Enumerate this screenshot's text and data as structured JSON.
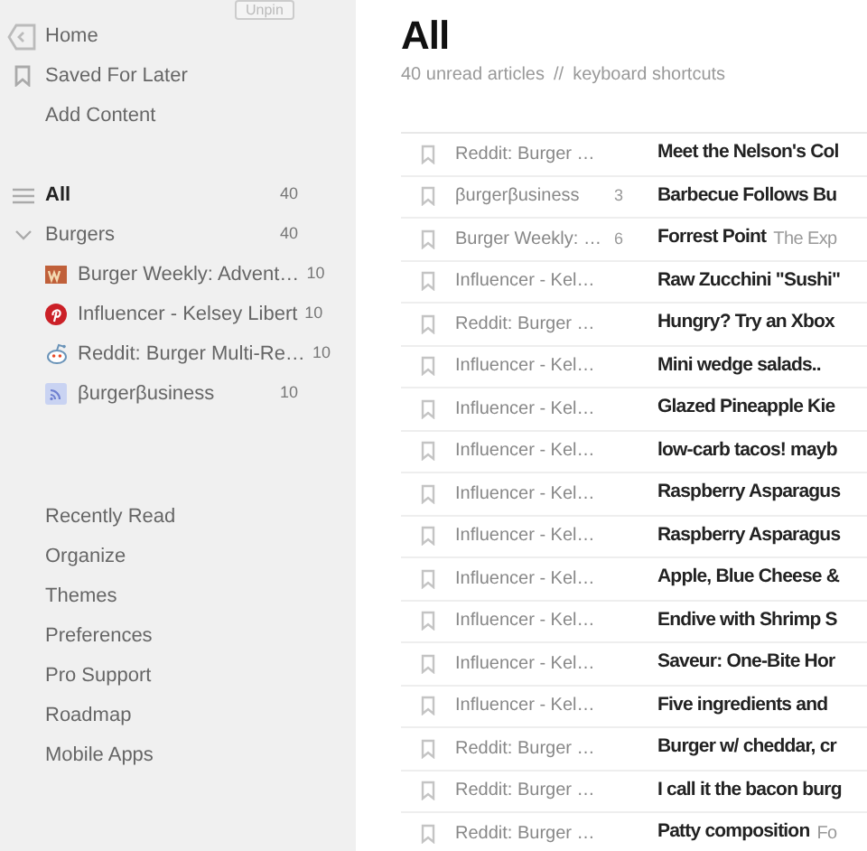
{
  "sidebar": {
    "unpin_button": "Unpin",
    "nav": [
      {
        "label": "Home",
        "kind": "home"
      },
      {
        "label": "Saved For Later",
        "kind": "saved"
      },
      {
        "label": "Add Content",
        "kind": "plain"
      }
    ],
    "all": {
      "label": "All",
      "count": "40",
      "selected": true
    },
    "category": {
      "label": "Burgers",
      "count": "40",
      "expanded": true,
      "feeds": [
        {
          "label": "Burger Weekly: Advent…",
          "count": "10",
          "kind": "rw"
        },
        {
          "label": "Influencer - Kelsey Libert",
          "count": "10",
          "kind": "pinterest"
        },
        {
          "label": "Reddit: Burger Multi-Re…",
          "count": "10",
          "kind": "reddit"
        },
        {
          "label": "βurgerβusiness",
          "count": "10",
          "kind": "rss"
        }
      ]
    },
    "links": [
      "Recently Read",
      "Organize",
      "Themes",
      "Preferences",
      "Pro Support",
      "Roadmap",
      "Mobile Apps"
    ]
  },
  "main": {
    "title": "All",
    "subtitle": "40 unread articles",
    "separator": "//",
    "shortcuts_link": "keyboard shortcuts",
    "articles": [
      {
        "source": "Reddit: Burger …",
        "title": "Meet the Nelson's Col"
      },
      {
        "source": "βurgerβusiness",
        "count": "3",
        "title": "Barbecue Follows Bu"
      },
      {
        "source": "Burger Weekly: …",
        "count": "6",
        "title": "Forrest Point",
        "snippet": "The Exp"
      },
      {
        "source": "Influencer - Kel…",
        "title": "Raw Zucchini \"Sushi\""
      },
      {
        "source": "Reddit: Burger …",
        "title": "Hungry? Try an Xbox"
      },
      {
        "source": "Influencer - Kel…",
        "title": "Mini wedge salads.."
      },
      {
        "source": "Influencer - Kel…",
        "title": "Glazed Pineapple Kie"
      },
      {
        "source": "Influencer - Kel…",
        "title": "low-carb tacos! mayb"
      },
      {
        "source": "Influencer - Kel…",
        "title": "Raspberry Asparagus"
      },
      {
        "source": "Influencer - Kel…",
        "title": "Raspberry Asparagus"
      },
      {
        "source": "Influencer - Kel…",
        "title": "Apple, Blue Cheese &"
      },
      {
        "source": "Influencer - Kel…",
        "title": "Endive with Shrimp S"
      },
      {
        "source": "Influencer - Kel…",
        "title": "Saveur: One-Bite Hor"
      },
      {
        "source": "Influencer - Kel…",
        "title": "Five ingredients and"
      },
      {
        "source": "Reddit: Burger …",
        "title": "Burger w/ cheddar, cr"
      },
      {
        "source": "Reddit: Burger …",
        "title": "I call it the bacon burg"
      },
      {
        "source": "Reddit: Burger …",
        "title": "Patty composition",
        "snippet": "Fo"
      }
    ]
  }
}
